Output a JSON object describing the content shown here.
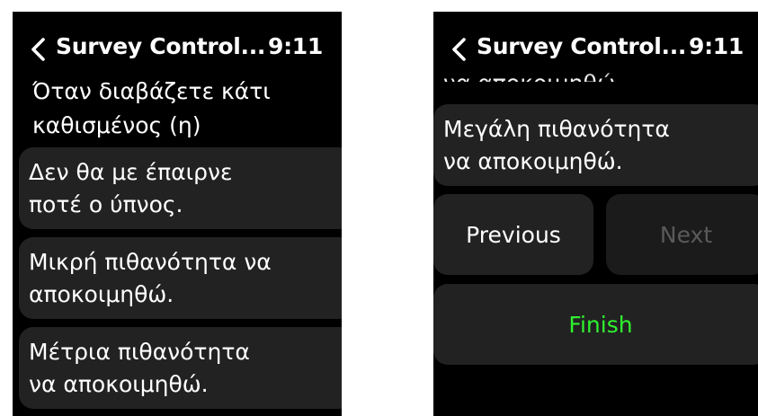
{
  "left_screen": {
    "back_icon": "chevron-left-icon",
    "title": "Survey Control...",
    "time": "9:11",
    "question": "Όταν διαβάζετε κάτι καθισμένος (η)",
    "options": [
      {
        "line1": "Δεν θα με έπαιρνε",
        "line2": "ποτέ ο ύπνος."
      },
      {
        "line1": "Μικρή πιθανότητα να",
        "line2": "αποκοιμηθώ."
      },
      {
        "line1": "Μέτρια πιθανότητα",
        "line2": "να αποκοιμηθώ."
      }
    ]
  },
  "right_screen": {
    "back_icon": "chevron-left-icon",
    "title": "Survey Control...",
    "time": "9:11",
    "partial_option": "να αποκοιμηθώ.",
    "option": {
      "line1": "Μεγάλη πιθανότητα",
      "line2": "να αποκοιμηθώ."
    },
    "previous_label": "Previous",
    "next_label": "Next",
    "finish_label": "Finish"
  },
  "colors": {
    "background": "#000000",
    "card": "#222222",
    "finish_text": "#2ff22f",
    "disabled_text": "#5a5a5a"
  }
}
